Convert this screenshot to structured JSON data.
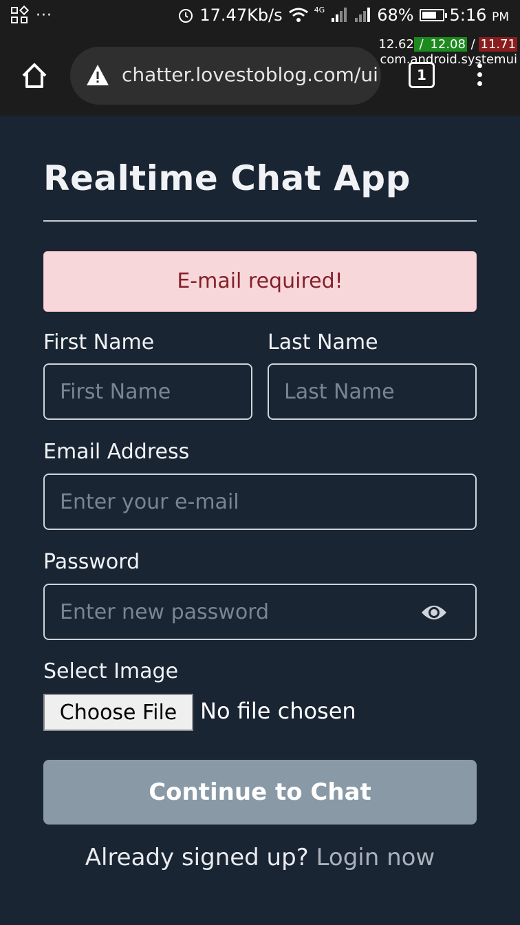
{
  "status_bar": {
    "speed": "17.47Kb/s",
    "network": "4G",
    "battery_percent": "68%",
    "battery_level": 0.68,
    "time": "5:16",
    "ampm": "PM",
    "dots": "···"
  },
  "perf_overlay": {
    "v1": "12.62",
    "sep1": " / ",
    "v2": "12.08",
    "sep2": " / ",
    "v3": "11.71",
    "process": "com.android.systemui"
  },
  "browser": {
    "url": "chatter.lovestoblog.com/ui",
    "tab_count": "1"
  },
  "page": {
    "title": "Realtime Chat App",
    "alert": "E-mail required!",
    "first_name_label": "First Name",
    "first_name_placeholder": "First Name",
    "last_name_label": "Last Name",
    "last_name_placeholder": "Last Name",
    "email_label": "Email Address",
    "email_placeholder": "Enter your e-mail",
    "password_label": "Password",
    "password_placeholder": "Enter new password",
    "image_label": "Select Image",
    "file_button": "Choose File",
    "file_status": "No file chosen",
    "submit": "Continue to Chat",
    "login_prompt": "Already signed up?",
    "login_link": "Login now"
  },
  "colors": {
    "background": "#1a2533",
    "alert_bg": "#f8d7da",
    "alert_text": "#842029",
    "button_bg": "#8999a6"
  }
}
